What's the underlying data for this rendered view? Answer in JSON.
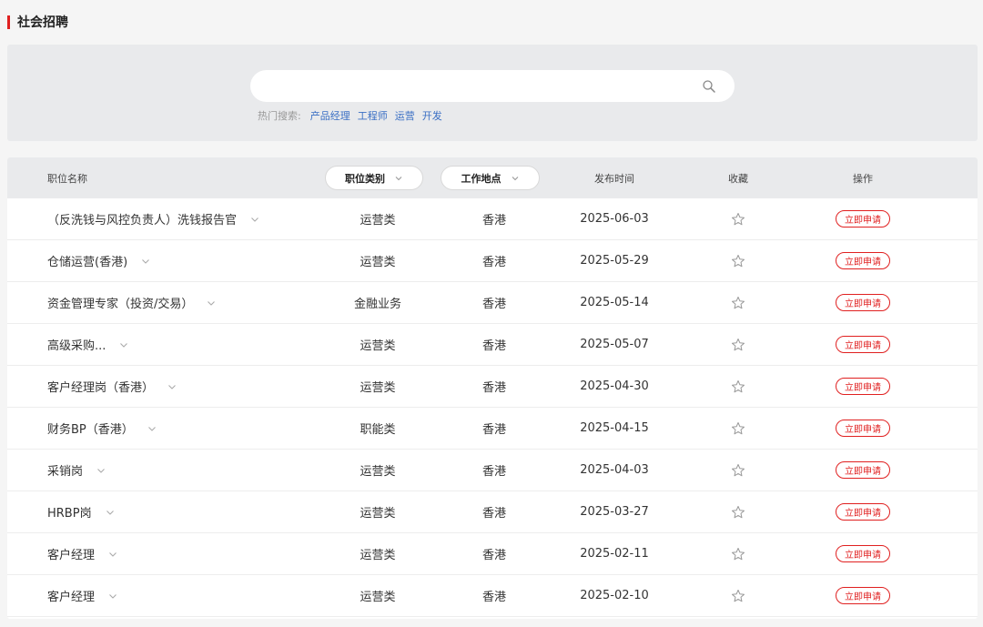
{
  "section": {
    "title": "社会招聘",
    "accent_color": "#e02020"
  },
  "search": {
    "placeholder": "",
    "icon": "search-icon",
    "hot_label": "热门搜索:",
    "hot_keywords": [
      "产品经理",
      "工程师",
      "运营",
      "开发"
    ]
  },
  "table": {
    "headers": {
      "title": "职位名称",
      "category": "职位类别",
      "location": "工作地点",
      "date": "发布时间",
      "favorite": "收藏",
      "action": "操作"
    },
    "apply_label": "立即申请",
    "rows": [
      {
        "title": "（反洗钱与风控负责人）洗钱报告官",
        "category": "运营类",
        "location": "香港",
        "date": "2025-06-03"
      },
      {
        "title": "仓储运营(香港)",
        "category": "运营类",
        "location": "香港",
        "date": "2025-05-29"
      },
      {
        "title": "资金管理专家（投资/交易）",
        "category": "金融业务",
        "location": "香港",
        "date": "2025-05-14"
      },
      {
        "title": "高级采购...",
        "category": "运营类",
        "location": "香港",
        "date": "2025-05-07"
      },
      {
        "title": "客户经理岗（香港）",
        "category": "运营类",
        "location": "香港",
        "date": "2025-04-30"
      },
      {
        "title": "财务BP（香港）",
        "category": "职能类",
        "location": "香港",
        "date": "2025-04-15"
      },
      {
        "title": "采销岗",
        "category": "运营类",
        "location": "香港",
        "date": "2025-04-03"
      },
      {
        "title": "HRBP岗",
        "category": "运营类",
        "location": "香港",
        "date": "2025-03-27"
      },
      {
        "title": "客户经理",
        "category": "运营类",
        "location": "香港",
        "date": "2025-02-11"
      },
      {
        "title": "客户经理",
        "category": "运营类",
        "location": "香港",
        "date": "2025-02-10"
      }
    ]
  }
}
